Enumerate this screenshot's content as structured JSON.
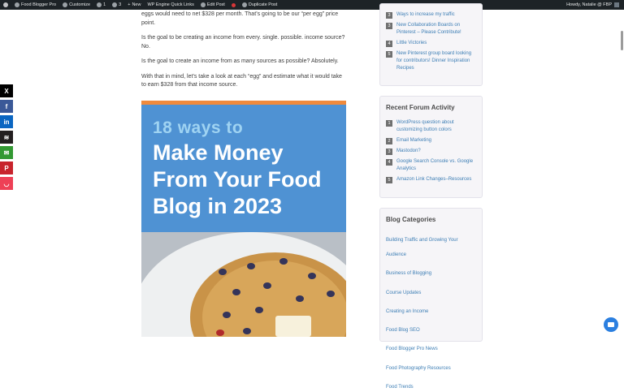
{
  "adminbar": {
    "site_name": "Food Blogger Pro",
    "customize": "Customize",
    "updates": "1",
    "comments": "3",
    "new": "New",
    "wp_engine": "WP Engine Quick Links",
    "edit_post": "Edit Post",
    "duplicate_post": "Duplicate Post",
    "howdy": "Howdy, Natalie @ FBP"
  },
  "share": {
    "buttons": [
      {
        "label": "X",
        "icon": "x-logo-icon",
        "color": "#000000"
      },
      {
        "label": "f",
        "icon": "facebook-icon",
        "color": "#3b5998"
      },
      {
        "label": "in",
        "icon": "linkedin-icon",
        "color": "#0a66c2"
      },
      {
        "label": "≋",
        "icon": "buffer-icon",
        "color": "#231f20"
      },
      {
        "label": "✉",
        "icon": "email-icon",
        "color": "#339933"
      },
      {
        "label": "P",
        "icon": "pinterest-icon",
        "color": "#c8232c"
      },
      {
        "label": "◡",
        "icon": "pocket-icon",
        "color": "#ee4056"
      }
    ]
  },
  "article": {
    "p1": "eggs would need to net $328 per month. That’s going to be our “per egg” price point.",
    "p2": "Is the goal to be creating an income from every. single. possible. income source? No.",
    "p3": "Is the goal to create an income from as many sources as possible? Absolutely.",
    "p4": "With that in mind, let’s take a look at each “egg” and estimate what it would take to earn $328 from that income source.",
    "hero_line1": "18 ways to",
    "hero_line2": "Make Money",
    "hero_line3": "From Your Food",
    "hero_line4": "Blog in 2023"
  },
  "sidebar": {
    "top_list": [
      {
        "num": "3",
        "text": "Ways to increase my traffic"
      },
      {
        "num": "3",
        "text": "New Collaboration Boards on Pinterest – Please Contribute!"
      },
      {
        "num": "4",
        "text": "Little Victories"
      },
      {
        "num": "5",
        "text": "New Pinterest group board looking for contributors! Dinner Inspiration Recipes"
      }
    ],
    "forum_title": "Recent Forum Activity",
    "forum_list": [
      {
        "num": "1",
        "text": "WordPress question about customizing button colors"
      },
      {
        "num": "2",
        "text": "Email Marketing"
      },
      {
        "num": "3",
        "text": "Mastodon?"
      },
      {
        "num": "4",
        "text": "Google Search Console vs. Google Analytics"
      },
      {
        "num": "5",
        "text": "Amazon Link Changes–Resources"
      }
    ],
    "categories_title": "Blog Categories",
    "categories": [
      "Building Traffic and Growing Your Audience",
      "Business of Blogging",
      "Course Updates",
      "Creating an Income",
      "Food Blog SEO",
      "Food Blogger Pro News",
      "Food Photography Resources",
      "Food Trends"
    ]
  },
  "colors": {
    "admin_bar": "#1d2327",
    "link": "#3d7eb5",
    "hero_blue": "#4f92d3",
    "hero_accent": "#f08a3c"
  }
}
